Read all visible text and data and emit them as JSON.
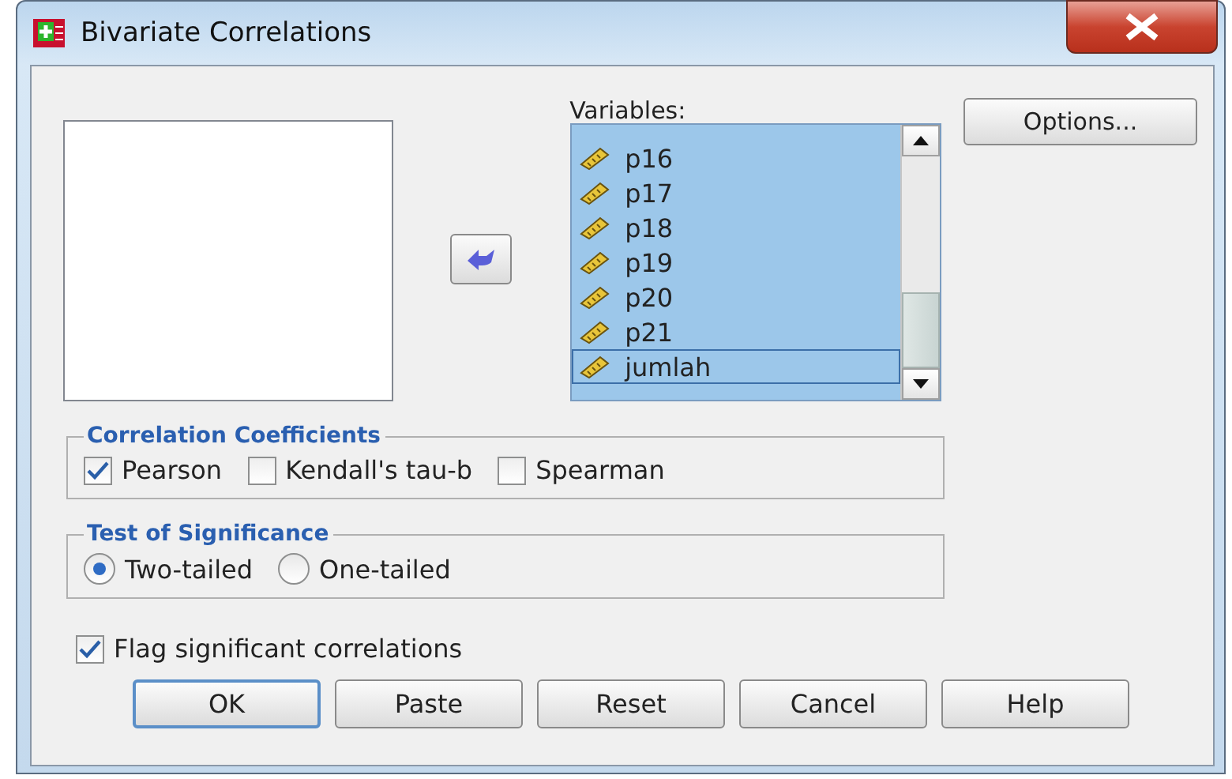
{
  "window": {
    "title": "Bivariate Correlations"
  },
  "variables": {
    "label": "Variables:",
    "items": [
      {
        "name": "p16",
        "selected": true,
        "focused": false
      },
      {
        "name": "p17",
        "selected": true,
        "focused": false
      },
      {
        "name": "p18",
        "selected": true,
        "focused": false
      },
      {
        "name": "p19",
        "selected": true,
        "focused": false
      },
      {
        "name": "p20",
        "selected": true,
        "focused": false
      },
      {
        "name": "p21",
        "selected": true,
        "focused": false
      },
      {
        "name": "jumlah",
        "selected": true,
        "focused": true
      }
    ]
  },
  "options_button": "Options...",
  "correlation_coefficients": {
    "title": "Correlation Coefficients",
    "options": [
      {
        "label": "Pearson",
        "checked": true
      },
      {
        "label": "Kendall's tau-b",
        "checked": false
      },
      {
        "label": "Spearman",
        "checked": false
      }
    ]
  },
  "test_of_significance": {
    "title": "Test of Significance",
    "options": [
      {
        "label": "Two-tailed",
        "selected": true
      },
      {
        "label": "One-tailed",
        "selected": false
      }
    ]
  },
  "flag": {
    "label": "Flag significant correlations",
    "checked": true
  },
  "buttons": [
    {
      "label": "OK",
      "default": true
    },
    {
      "label": "Paste",
      "default": false
    },
    {
      "label": "Reset",
      "default": false
    },
    {
      "label": "Cancel",
      "default": false
    },
    {
      "label": "Help",
      "default": false
    }
  ]
}
